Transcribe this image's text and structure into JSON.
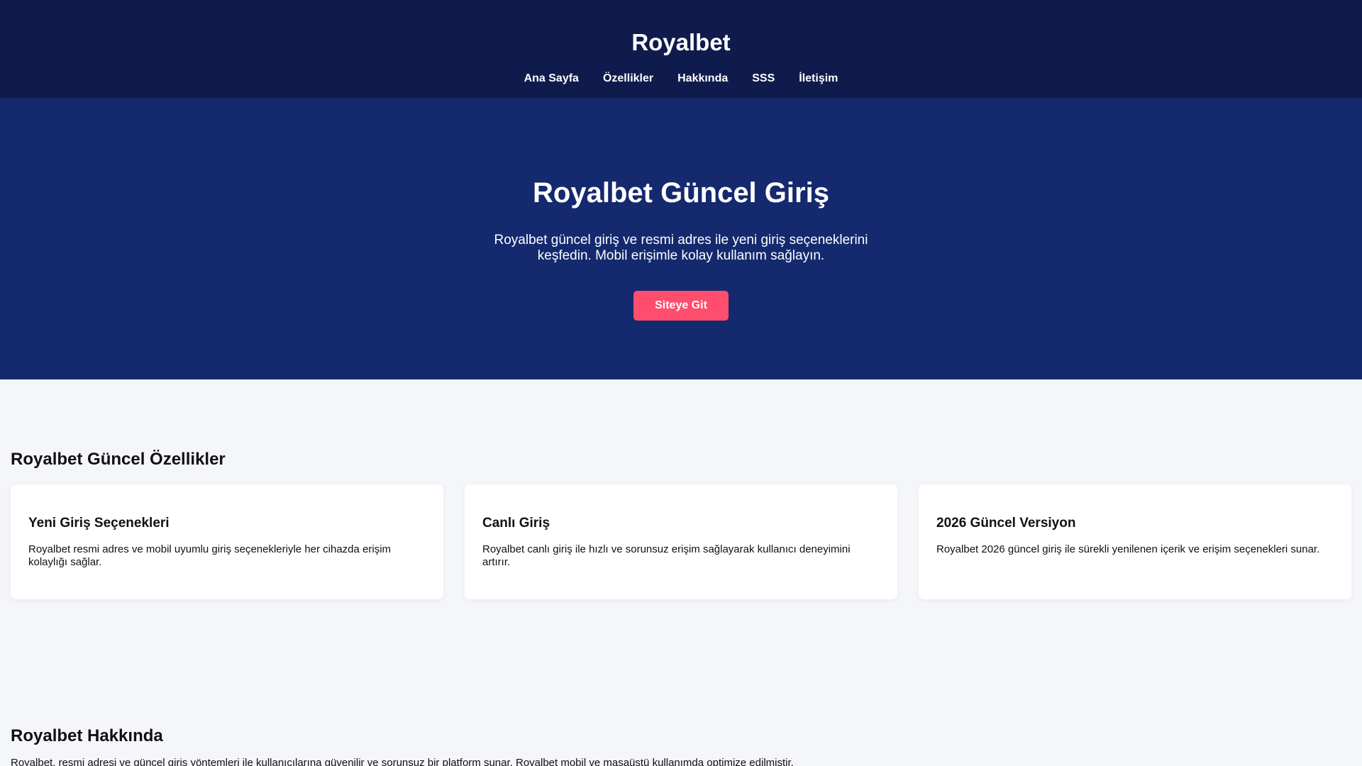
{
  "header": {
    "brand": "Royalbet",
    "nav": [
      "Ana Sayfa",
      "Özellikler",
      "Hakkında",
      "SSS",
      "İletişim"
    ]
  },
  "hero": {
    "title": "Royalbet Güncel Giriş",
    "text": "Royalbet güncel giriş ve resmi adres ile yeni giriş seçeneklerini keşfedin. Mobil erişimle kolay kullanım sağlayın.",
    "cta_label": "Siteye Git"
  },
  "features": {
    "title": "Royalbet Güncel Özellikler",
    "cards": [
      {
        "title": "Yeni Giriş Seçenekleri",
        "text": "Royalbet resmi adres ve mobil uyumlu giriş seçenekleriyle her cihazda erişim kolaylığı sağlar."
      },
      {
        "title": "Canlı Giriş",
        "text": "Royalbet canlı giriş ile hızlı ve sorunsuz erişim sağlayarak kullanıcı deneyimini artırır."
      },
      {
        "title": "2026 Güncel Versiyon",
        "text": "Royalbet 2026 güncel giriş ile sürekli yenilenen içerik ve erişim seçenekleri sunar."
      }
    ]
  },
  "about": {
    "title": "Royalbet Hakkında",
    "text": "Royalbet, resmi adresi ve güncel giriş yöntemleri ile kullanıcılarına güvenilir ve sorunsuz bir platform sunar. Royalbet mobil ve masaüstü kullanımda optimize edilmiştir."
  },
  "colors": {
    "header_bg": "#101b4d",
    "hero_bg": "#14296e",
    "accent": "#ff4d6d",
    "page_bg": "#f5f6fa"
  }
}
